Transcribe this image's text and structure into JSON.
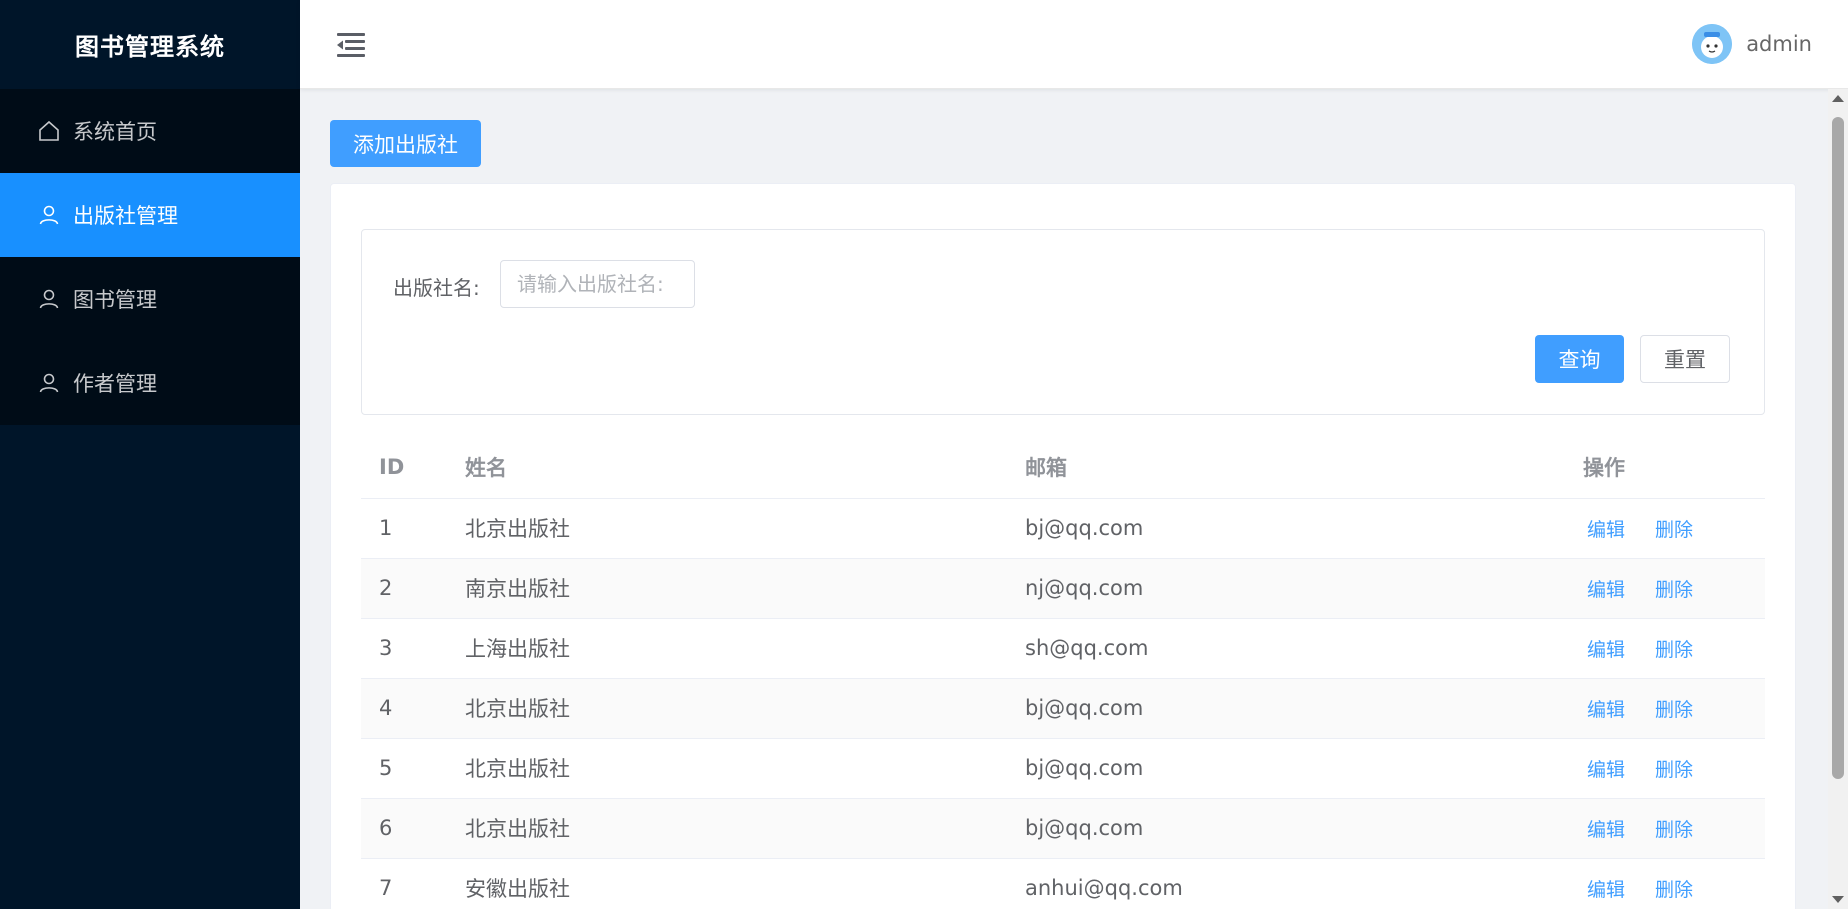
{
  "app": {
    "title": "图书管理系统"
  },
  "sidebar": {
    "items": [
      {
        "label": "系统首页",
        "icon": "home-icon"
      },
      {
        "label": "出版社管理",
        "icon": "user-icon",
        "active": true
      },
      {
        "label": "图书管理",
        "icon": "user-icon"
      },
      {
        "label": "作者管理",
        "icon": "user-icon"
      }
    ]
  },
  "header": {
    "username": "admin"
  },
  "toolbar": {
    "add_label": "添加出版社"
  },
  "search": {
    "label": "出版社名:",
    "placeholder": "请输入出版社名:",
    "query_label": "查询",
    "reset_label": "重置"
  },
  "table": {
    "columns": [
      "ID",
      "姓名",
      "邮箱",
      "操作"
    ],
    "edit_label": "编辑",
    "delete_label": "删除",
    "rows": [
      {
        "id": "1",
        "name": "北京出版社",
        "email": "bj@qq.com"
      },
      {
        "id": "2",
        "name": "南京出版社",
        "email": "nj@qq.com"
      },
      {
        "id": "3",
        "name": "上海出版社",
        "email": "sh@qq.com"
      },
      {
        "id": "4",
        "name": "北京出版社",
        "email": "bj@qq.com"
      },
      {
        "id": "5",
        "name": "北京出版社",
        "email": "bj@qq.com"
      },
      {
        "id": "6",
        "name": "北京出版社",
        "email": "bj@qq.com"
      },
      {
        "id": "7",
        "name": "安徽出版社",
        "email": "anhui@qq.com"
      }
    ]
  },
  "colors": {
    "sidebar_bg": "#001529",
    "menu_bg": "#000c17",
    "active": "#1890ff",
    "primary": "#409eff"
  }
}
